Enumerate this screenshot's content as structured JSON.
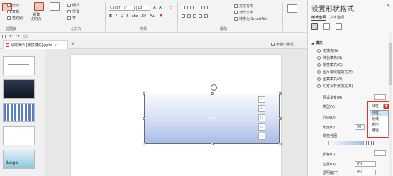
{
  "ribbon": {
    "clipboard": {
      "cut": "剪切",
      "copy": "复制",
      "format_painter": "格式刷"
    },
    "slides": {
      "new_slide": "新建\n幻灯片",
      "layout": "版式",
      "reset": "重置",
      "section": "节",
      "label": "幻灯片"
    },
    "font": {
      "name": "Calibri (正",
      "size": "18",
      "label": "字体",
      "bold": "B",
      "italic": "I",
      "underline": "U",
      "strike": "S",
      "shadow": "abc",
      "spacing": "AV",
      "case": "Aa",
      "color": "A"
    },
    "paragraph": {
      "label": "段落",
      "text_direction": "文字方向",
      "align_text": "对齐文本",
      "convert_smartart": "转换为 SmartArt"
    },
    "left_group_label": "剪贴板"
  },
  "qat": {
    "save": "save-icon",
    "undo": "undo-icon",
    "redo": "redo-icon",
    "items": [
      "↶",
      "↷",
      "▭"
    ]
  },
  "tabs": {
    "document_tab": "动效演示 [兼容模式].pptx",
    "close": "×",
    "add": "+",
    "multi_window": "多窗口模式"
  },
  "thumbnails": {
    "slides": [
      "1",
      "2",
      "3",
      "4",
      "5"
    ]
  },
  "canvas": {
    "shape_text": "123"
  },
  "pane": {
    "title": "设置形状格式",
    "close": "×",
    "tabs": [
      "形状选项",
      "文本选项"
    ],
    "section": "填充",
    "fill_options": [
      "无填充(N)",
      "纯色填充(S)",
      "渐变填充(G)",
      "图片或纹理填充(P)",
      "图案填充(A)",
      "幻灯片背景填充(B)"
    ],
    "selected_fill": "渐变填充(G)",
    "props": {
      "preset": "预设渐变(R)",
      "type": "类型(Y)",
      "direction": "方向(D)",
      "angle": "角度(E)",
      "angle_value": "90°",
      "stops": "渐变光圈",
      "color": "颜色(C)",
      "position": "位置(O)",
      "position_value": "0%",
      "transparency": "透明度(T)",
      "transparency_value": "0%"
    },
    "type_value": "线性",
    "type_options": [
      "线性",
      "射线",
      "矩形",
      "路径"
    ]
  }
}
